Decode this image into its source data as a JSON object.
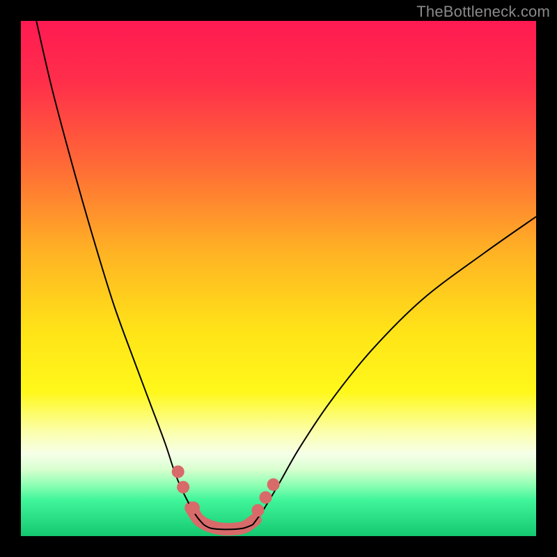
{
  "watermark": "TheBottleneck.com",
  "gradient": {
    "stops": [
      {
        "pct": 0,
        "color": "#ff1a52"
      },
      {
        "pct": 12,
        "color": "#ff2f4a"
      },
      {
        "pct": 28,
        "color": "#ff6a36"
      },
      {
        "pct": 45,
        "color": "#ffb324"
      },
      {
        "pct": 60,
        "color": "#ffe318"
      },
      {
        "pct": 72,
        "color": "#fff81a"
      },
      {
        "pct": 80,
        "color": "#fbffb0"
      },
      {
        "pct": 84,
        "color": "#f6ffe8"
      },
      {
        "pct": 87,
        "color": "#d9ffd0"
      },
      {
        "pct": 90,
        "color": "#8fffb4"
      },
      {
        "pct": 93,
        "color": "#40f59a"
      },
      {
        "pct": 100,
        "color": "#13c86f"
      }
    ]
  },
  "chart_data": {
    "type": "line",
    "title": "",
    "xlabel": "",
    "ylabel": "",
    "xlim": [
      0,
      100
    ],
    "ylim": [
      0,
      100
    ],
    "grid": false,
    "series": [
      {
        "name": "left-curve",
        "x": [
          3,
          6,
          10,
          14,
          18,
          22,
          25,
          28,
          30,
          32,
          34,
          35.5
        ],
        "y": [
          100,
          87,
          72,
          58,
          45,
          34,
          26,
          18,
          12,
          7.5,
          4,
          2.2
        ]
      },
      {
        "name": "right-curve",
        "x": [
          45,
          47,
          50,
          54,
          60,
          68,
          78,
          90,
          100
        ],
        "y": [
          2.2,
          5,
          10,
          17,
          26,
          36,
          46,
          55,
          62
        ]
      },
      {
        "name": "valley-floor",
        "x": [
          35.5,
          37,
          40,
          43,
          45
        ],
        "y": [
          2.2,
          1.5,
          1.3,
          1.5,
          2.2
        ]
      }
    ],
    "markers": {
      "name": "highlight-dots",
      "color": "#d86a6a",
      "radius_px": 9,
      "points": [
        {
          "x": 30.5,
          "y": 12.5
        },
        {
          "x": 31.5,
          "y": 9.5
        },
        {
          "x": 33.5,
          "y": 5.5
        },
        {
          "x": 46.0,
          "y": 5.0
        },
        {
          "x": 47.5,
          "y": 7.5
        },
        {
          "x": 49.0,
          "y": 10.0
        }
      ]
    },
    "valley_band": {
      "name": "valley-band",
      "color": "#d86a6a",
      "thickness_px": 18,
      "points": [
        {
          "x": 33.0,
          "y": 5.5
        },
        {
          "x": 34.5,
          "y": 3.2
        },
        {
          "x": 36.5,
          "y": 2.0
        },
        {
          "x": 39.0,
          "y": 1.4
        },
        {
          "x": 41.5,
          "y": 1.4
        },
        {
          "x": 43.5,
          "y": 1.8
        },
        {
          "x": 45.5,
          "y": 3.2
        }
      ]
    }
  }
}
